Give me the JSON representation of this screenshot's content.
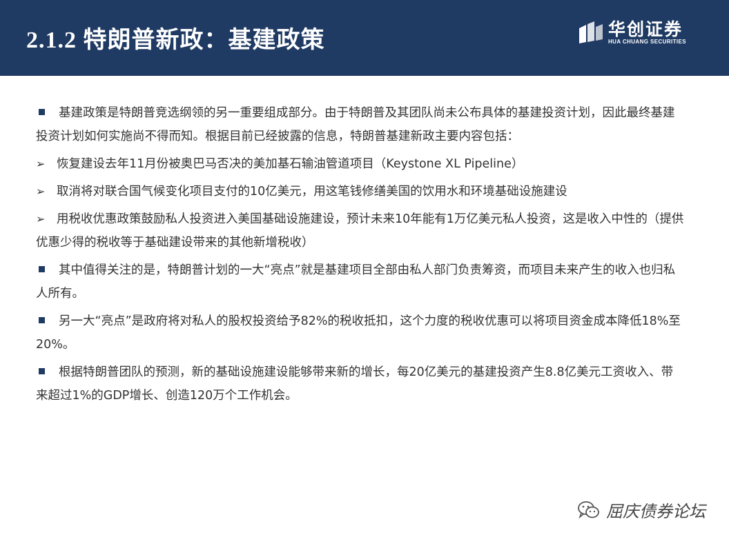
{
  "header": {
    "title": "2.1.2  特朗普新政：基建政策",
    "logo_cn": "华创证券",
    "logo_en": "HUA CHUANG SECURITIES"
  },
  "paragraphs": [
    {
      "bullet": "square",
      "text": "基建政策是特朗普竞选纲领的另一重要组成部分。由于特朗普及其团队尚未公布具体的基建投资计划，因此最终基建投资计划如何实施尚不得而知。根据目前已经披露的信息，特朗普基建新政主要内容包括："
    },
    {
      "bullet": "arrow",
      "text": "恢复建设去年11月份被奥巴马否决的美加基石输油管道项目（Keystone XL Pipeline）"
    },
    {
      "bullet": "arrow",
      "text": "取消将对联合国气候变化项目支付的10亿美元，用这笔钱修缮美国的饮用水和环境基础设施建设"
    },
    {
      "bullet": "arrow",
      "text": "用税收优惠政策鼓励私人投资进入美国基础设施建设，预计未来10年能有1万亿美元私人投资，这是收入中性的（提供优惠少得的税收等于基础建设带来的其他新增税收）"
    },
    {
      "bullet": "square",
      "text": "其中值得关注的是，特朗普计划的一大“亮点”就是基建项目全部由私人部门负责筹资，而项目未来产生的收入也归私人所有。"
    },
    {
      "bullet": "square",
      "text": "另一大“亮点”是政府将对私人的股权投资给予82%的税收抵扣，这个力度的税收优惠可以将项目资金成本降低18%至20%。"
    },
    {
      "bullet": "square",
      "text": "根据特朗普团队的预测，新的基础设施建设能够带来新的增长，每20亿美元的基建投资产生8.8亿美元工资收入、带来超过1%的GDP增长、创造120万个工作机会。"
    }
  ],
  "watermark": {
    "text": "屈庆债券论坛",
    "icon": "wechat-icon"
  },
  "colors": {
    "header_bg": "#1f3a63",
    "text": "#333333"
  }
}
